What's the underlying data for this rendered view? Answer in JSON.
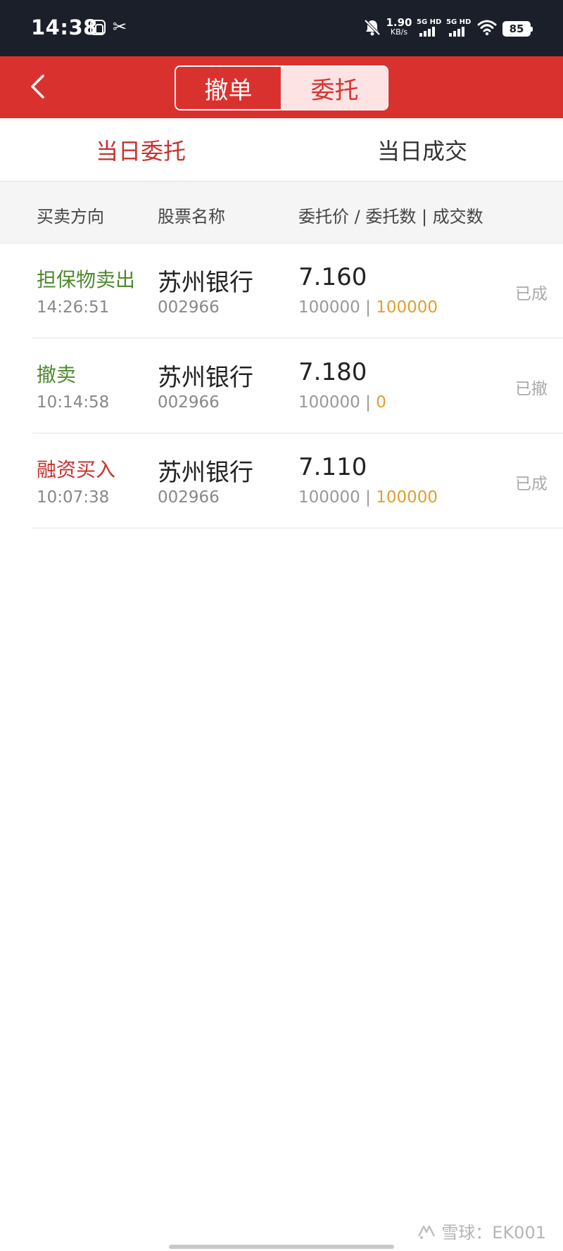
{
  "status_bar": {
    "time": "14:38",
    "net_speed_value": "1.90",
    "net_speed_unit": "KB/s",
    "signal_1_label": "5G HD",
    "signal_2_label": "5G HD",
    "battery": "85",
    "icons": [
      "app-notification-icon",
      "app-x-icon",
      "mute-icon",
      "wifi-icon",
      "battery-icon"
    ]
  },
  "header": {
    "back_icon": "chevron-left-icon",
    "segment_cancel": "撤单",
    "segment_order": "委托",
    "active_segment": "委托",
    "colors": {
      "brand_red": "#d9322e",
      "active_segment_bg": "#fde3e3"
    }
  },
  "tabs": {
    "today_orders": "当日委托",
    "today_deals": "当日成交",
    "active": "当日委托"
  },
  "columns": {
    "direction": "买卖方向",
    "stock_name": "股票名称",
    "price_qty": "委托价 / 委托数 | 成交数"
  },
  "orders": [
    {
      "direction": "担保物卖出",
      "time": "14:26:51",
      "name": "苏州银行",
      "code": "002966",
      "price": "7.160",
      "order_qty": "100000",
      "sep": "|",
      "filled_qty": "100000",
      "status": "已成"
    },
    {
      "direction": "撤卖",
      "time": "10:14:58",
      "name": "苏州银行",
      "code": "002966",
      "price": "7.180",
      "order_qty": "100000",
      "sep": "|",
      "filled_qty": "0",
      "status": "已撤"
    },
    {
      "direction": "融资买入",
      "time": "10:07:38",
      "name": "苏州银行",
      "code": "002966",
      "price": "7.110",
      "order_qty": "100000",
      "sep": "|",
      "filled_qty": "100000",
      "status": "已成"
    }
  ],
  "watermark": {
    "text": "雪球：EK001",
    "icon": "xueqiu-logo-icon"
  },
  "colors": {
    "sell_green": "#4e8a2e",
    "buy_red": "#c8322f",
    "filled_orange": "#e0a030"
  }
}
